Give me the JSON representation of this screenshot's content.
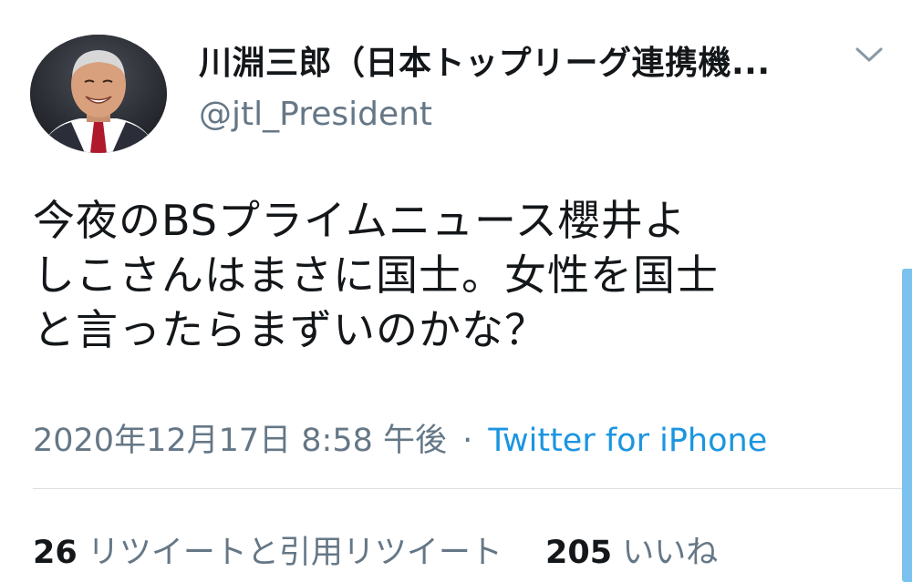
{
  "user": {
    "display_name": "川淵三郎（日本トップリーグ連携機...",
    "handle": "@jtl_President"
  },
  "tweet": {
    "lines": [
      "今夜のBSプライムニュース櫻井よ",
      "しこさんはまさに国士。女性を国士",
      "と言ったらまずいのかな？"
    ],
    "date": "2020年12月17日 8:58 午後",
    "separator": "·",
    "source": "Twitter for iPhone"
  },
  "stats": {
    "retweets_count": "26",
    "retweets_label": "リツイートと引用リツイート",
    "likes_count": "205",
    "likes_label": "いいね"
  },
  "icons": {
    "menu": "chevron-down-icon",
    "avatar": "profile-photo"
  },
  "colors": {
    "text": "#14171a",
    "secondary": "#657786",
    "link": "#1b95e0",
    "divider": "#d9dfe3",
    "scrollbar": "#7cc2ee"
  }
}
